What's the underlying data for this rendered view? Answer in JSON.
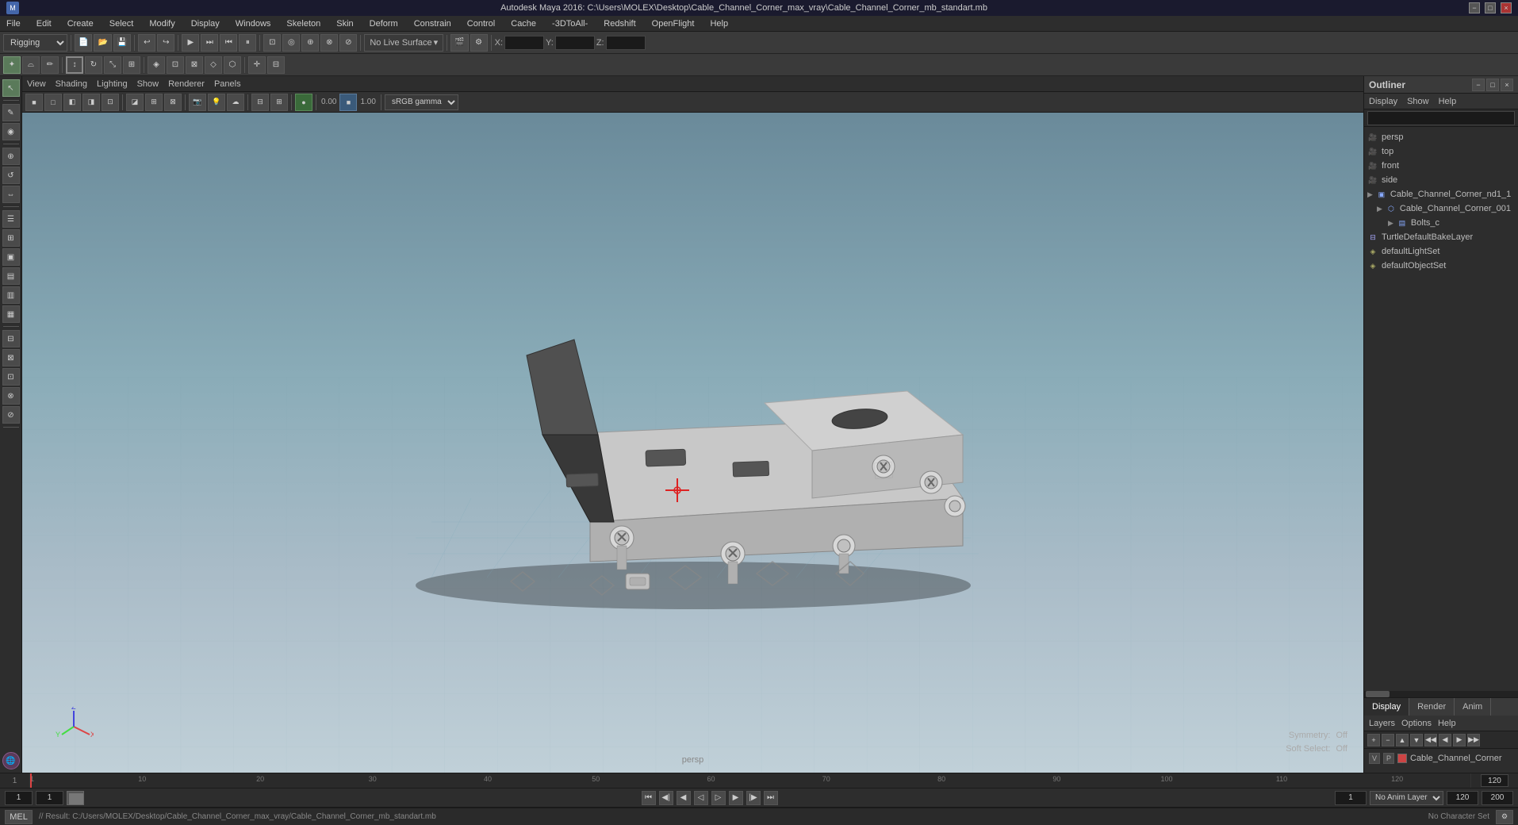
{
  "title_bar": {
    "text": "Autodesk Maya 2016: C:\\Users\\MOLEX\\Desktop\\Cable_Channel_Corner_max_vray\\Cable_Channel_Corner_mb_standart.mb",
    "minimize_label": "−",
    "maximize_label": "□",
    "close_label": "×"
  },
  "menu_bar": {
    "items": [
      "File",
      "Edit",
      "Create",
      "Select",
      "Modify",
      "Display",
      "Windows",
      "Skeleton",
      "Skin",
      "Deform",
      "Constrain",
      "Control",
      "Cache",
      "-3DToAll-",
      "Redshift",
      "OpenFlight",
      "Help"
    ]
  },
  "toolbar1": {
    "rigging_label": "Rigging",
    "no_live_surface": "No Live Surface",
    "x_label": "X:",
    "y_label": "Y:",
    "z_label": "Z:"
  },
  "toolbar2": {
    "icons": [
      "select",
      "lasso",
      "paint",
      "move",
      "rotate",
      "scale",
      "snap-grid",
      "snap-curve",
      "snap-point",
      "snap-view",
      "plus",
      "frame"
    ]
  },
  "viewport": {
    "menu_items": [
      "View",
      "Shading",
      "Lighting",
      "Show",
      "Renderer",
      "Panels"
    ],
    "camera": "persp",
    "gamma_label": "sRGB gamma",
    "gamma_value": "0.00",
    "gamma_scale": "1.00",
    "symmetry_label": "Symmetry:",
    "symmetry_value": "Off",
    "soft_select_label": "Soft Select:",
    "soft_select_value": "Off"
  },
  "outliner": {
    "title": "Outliner",
    "menu_items": [
      "Display",
      "Show",
      "Help"
    ],
    "search_placeholder": "",
    "tree_items": [
      {
        "name": "persp",
        "type": "camera",
        "indent": 0
      },
      {
        "name": "top",
        "type": "camera",
        "indent": 0
      },
      {
        "name": "front",
        "type": "camera",
        "indent": 0
      },
      {
        "name": "side",
        "type": "camera",
        "indent": 0
      },
      {
        "name": "Cable_Channel_Corner_nd1_1",
        "type": "group",
        "indent": 0
      },
      {
        "name": "Cable_Channel_Corner_001",
        "type": "mesh",
        "indent": 1
      },
      {
        "name": "Bolts_c",
        "type": "group",
        "indent": 2
      },
      {
        "name": "TurtleDefaultBakeLayer",
        "type": "layer",
        "indent": 0
      },
      {
        "name": "defaultLightSet",
        "type": "set",
        "indent": 0
      },
      {
        "name": "defaultObjectSet",
        "type": "set",
        "indent": 0
      }
    ]
  },
  "outliner_bottom": {
    "tabs": [
      "Display",
      "Render",
      "Anim"
    ],
    "active_tab": "Display",
    "layers_menu": [
      "Layers",
      "Options",
      "Help"
    ],
    "layer_row": {
      "v_label": "V",
      "p_label": "P",
      "color": "#cc4444",
      "name": "Cable_Channel_Corner"
    }
  },
  "timeline": {
    "start": 1,
    "end": 120,
    "current": 1,
    "ticks": [
      1,
      10,
      20,
      30,
      40,
      50,
      60,
      70,
      80,
      90,
      100,
      110,
      120
    ],
    "range_start": 1,
    "range_end": 200,
    "anim_layer": "No Anim Layer"
  },
  "playback": {
    "frame_input": "1",
    "sub_frame": "1",
    "frame_display": "1",
    "end_frame": "120",
    "end_range": "200",
    "buttons": [
      "skip-back",
      "prev-key",
      "prev-frame",
      "play-back",
      "play-fwd",
      "next-frame",
      "next-key",
      "skip-fwd"
    ]
  },
  "status_bar": {
    "mode": "MEL",
    "result_text": "// Result: C:/Users/MOLEX/Desktop/Cable_Channel_Corner_max_vray/Cable_Channel_Corner_mb_standart.mb",
    "char_set_label": "No Character Set"
  }
}
